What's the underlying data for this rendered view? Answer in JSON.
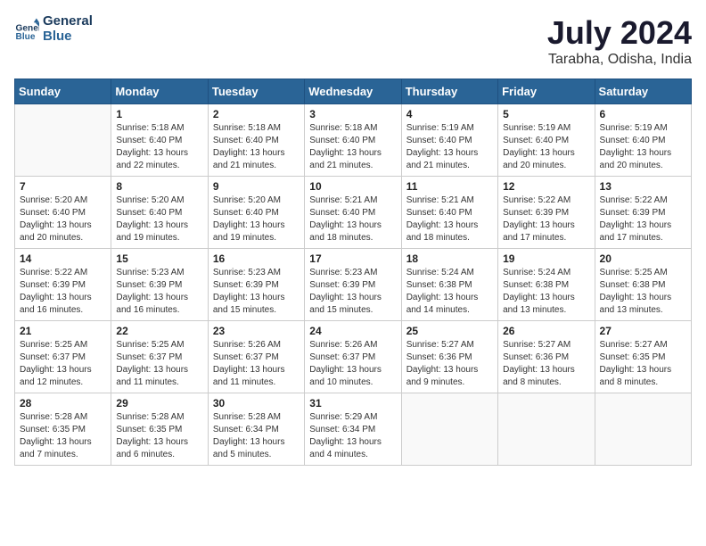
{
  "header": {
    "logo_line1": "General",
    "logo_line2": "Blue",
    "month": "July 2024",
    "location": "Tarabha, Odisha, India"
  },
  "days_of_week": [
    "Sunday",
    "Monday",
    "Tuesday",
    "Wednesday",
    "Thursday",
    "Friday",
    "Saturday"
  ],
  "weeks": [
    [
      {
        "day": "",
        "info": ""
      },
      {
        "day": "1",
        "info": "Sunrise: 5:18 AM\nSunset: 6:40 PM\nDaylight: 13 hours\nand 22 minutes."
      },
      {
        "day": "2",
        "info": "Sunrise: 5:18 AM\nSunset: 6:40 PM\nDaylight: 13 hours\nand 21 minutes."
      },
      {
        "day": "3",
        "info": "Sunrise: 5:18 AM\nSunset: 6:40 PM\nDaylight: 13 hours\nand 21 minutes."
      },
      {
        "day": "4",
        "info": "Sunrise: 5:19 AM\nSunset: 6:40 PM\nDaylight: 13 hours\nand 21 minutes."
      },
      {
        "day": "5",
        "info": "Sunrise: 5:19 AM\nSunset: 6:40 PM\nDaylight: 13 hours\nand 20 minutes."
      },
      {
        "day": "6",
        "info": "Sunrise: 5:19 AM\nSunset: 6:40 PM\nDaylight: 13 hours\nand 20 minutes."
      }
    ],
    [
      {
        "day": "7",
        "info": "Sunrise: 5:20 AM\nSunset: 6:40 PM\nDaylight: 13 hours\nand 20 minutes."
      },
      {
        "day": "8",
        "info": "Sunrise: 5:20 AM\nSunset: 6:40 PM\nDaylight: 13 hours\nand 19 minutes."
      },
      {
        "day": "9",
        "info": "Sunrise: 5:20 AM\nSunset: 6:40 PM\nDaylight: 13 hours\nand 19 minutes."
      },
      {
        "day": "10",
        "info": "Sunrise: 5:21 AM\nSunset: 6:40 PM\nDaylight: 13 hours\nand 18 minutes."
      },
      {
        "day": "11",
        "info": "Sunrise: 5:21 AM\nSunset: 6:40 PM\nDaylight: 13 hours\nand 18 minutes."
      },
      {
        "day": "12",
        "info": "Sunrise: 5:22 AM\nSunset: 6:39 PM\nDaylight: 13 hours\nand 17 minutes."
      },
      {
        "day": "13",
        "info": "Sunrise: 5:22 AM\nSunset: 6:39 PM\nDaylight: 13 hours\nand 17 minutes."
      }
    ],
    [
      {
        "day": "14",
        "info": "Sunrise: 5:22 AM\nSunset: 6:39 PM\nDaylight: 13 hours\nand 16 minutes."
      },
      {
        "day": "15",
        "info": "Sunrise: 5:23 AM\nSunset: 6:39 PM\nDaylight: 13 hours\nand 16 minutes."
      },
      {
        "day": "16",
        "info": "Sunrise: 5:23 AM\nSunset: 6:39 PM\nDaylight: 13 hours\nand 15 minutes."
      },
      {
        "day": "17",
        "info": "Sunrise: 5:23 AM\nSunset: 6:39 PM\nDaylight: 13 hours\nand 15 minutes."
      },
      {
        "day": "18",
        "info": "Sunrise: 5:24 AM\nSunset: 6:38 PM\nDaylight: 13 hours\nand 14 minutes."
      },
      {
        "day": "19",
        "info": "Sunrise: 5:24 AM\nSunset: 6:38 PM\nDaylight: 13 hours\nand 13 minutes."
      },
      {
        "day": "20",
        "info": "Sunrise: 5:25 AM\nSunset: 6:38 PM\nDaylight: 13 hours\nand 13 minutes."
      }
    ],
    [
      {
        "day": "21",
        "info": "Sunrise: 5:25 AM\nSunset: 6:37 PM\nDaylight: 13 hours\nand 12 minutes."
      },
      {
        "day": "22",
        "info": "Sunrise: 5:25 AM\nSunset: 6:37 PM\nDaylight: 13 hours\nand 11 minutes."
      },
      {
        "day": "23",
        "info": "Sunrise: 5:26 AM\nSunset: 6:37 PM\nDaylight: 13 hours\nand 11 minutes."
      },
      {
        "day": "24",
        "info": "Sunrise: 5:26 AM\nSunset: 6:37 PM\nDaylight: 13 hours\nand 10 minutes."
      },
      {
        "day": "25",
        "info": "Sunrise: 5:27 AM\nSunset: 6:36 PM\nDaylight: 13 hours\nand 9 minutes."
      },
      {
        "day": "26",
        "info": "Sunrise: 5:27 AM\nSunset: 6:36 PM\nDaylight: 13 hours\nand 8 minutes."
      },
      {
        "day": "27",
        "info": "Sunrise: 5:27 AM\nSunset: 6:35 PM\nDaylight: 13 hours\nand 8 minutes."
      }
    ],
    [
      {
        "day": "28",
        "info": "Sunrise: 5:28 AM\nSunset: 6:35 PM\nDaylight: 13 hours\nand 7 minutes."
      },
      {
        "day": "29",
        "info": "Sunrise: 5:28 AM\nSunset: 6:35 PM\nDaylight: 13 hours\nand 6 minutes."
      },
      {
        "day": "30",
        "info": "Sunrise: 5:28 AM\nSunset: 6:34 PM\nDaylight: 13 hours\nand 5 minutes."
      },
      {
        "day": "31",
        "info": "Sunrise: 5:29 AM\nSunset: 6:34 PM\nDaylight: 13 hours\nand 4 minutes."
      },
      {
        "day": "",
        "info": ""
      },
      {
        "day": "",
        "info": ""
      },
      {
        "day": "",
        "info": ""
      }
    ]
  ]
}
